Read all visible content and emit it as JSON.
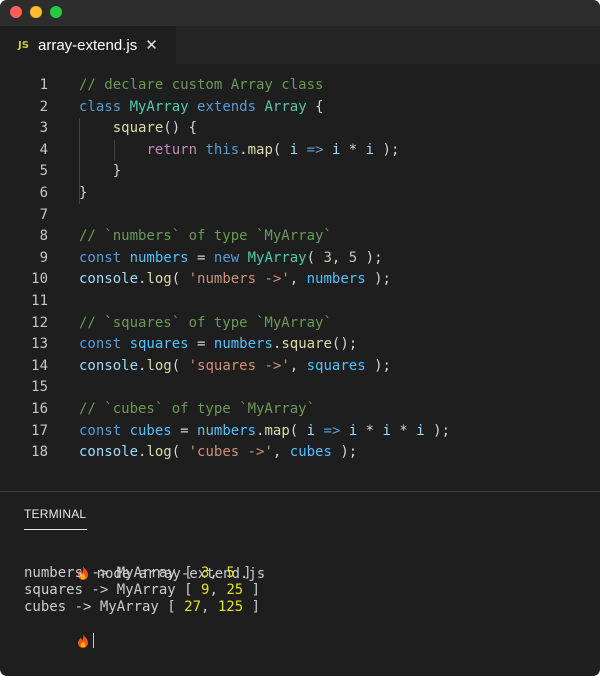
{
  "window": {
    "traffic_lights": [
      "close",
      "minimize",
      "zoom"
    ],
    "colors": {
      "background": "#1e1e1e",
      "titlebar": "#2d2d2d",
      "tabbar": "#252526"
    }
  },
  "tab": {
    "icon_label": "JS",
    "filename": "array-extend.js",
    "close_glyph": "✕"
  },
  "code_lines": [
    {
      "num": "1",
      "tokens": [
        {
          "t": "// declare custom Array class",
          "c": "comment"
        }
      ]
    },
    {
      "num": "2",
      "tokens": [
        {
          "t": "class ",
          "c": "keyword"
        },
        {
          "t": "MyArray",
          "c": "class"
        },
        {
          "t": " ",
          "c": "plain"
        },
        {
          "t": "extends",
          "c": "keyword"
        },
        {
          "t": " ",
          "c": "plain"
        },
        {
          "t": "Array",
          "c": "class"
        },
        {
          "t": " {",
          "c": "plain"
        }
      ]
    },
    {
      "num": "3",
      "tokens": [
        {
          "t": "    ",
          "c": "plain"
        },
        {
          "t": "square",
          "c": "func"
        },
        {
          "t": "() {",
          "c": "plain"
        }
      ]
    },
    {
      "num": "4",
      "tokens": [
        {
          "t": "        ",
          "c": "plain"
        },
        {
          "t": "return ",
          "c": "control"
        },
        {
          "t": "this",
          "c": "keyword"
        },
        {
          "t": ".",
          "c": "plain"
        },
        {
          "t": "map",
          "c": "func"
        },
        {
          "t": "( ",
          "c": "plain"
        },
        {
          "t": "i",
          "c": "var"
        },
        {
          "t": " ",
          "c": "plain"
        },
        {
          "t": "=>",
          "c": "keyword"
        },
        {
          "t": " ",
          "c": "plain"
        },
        {
          "t": "i",
          "c": "var"
        },
        {
          "t": " * ",
          "c": "plain"
        },
        {
          "t": "i",
          "c": "var"
        },
        {
          "t": " );",
          "c": "plain"
        }
      ]
    },
    {
      "num": "5",
      "tokens": [
        {
          "t": "    }",
          "c": "plain"
        }
      ]
    },
    {
      "num": "6",
      "tokens": [
        {
          "t": "}",
          "c": "plain"
        }
      ]
    },
    {
      "num": "7",
      "tokens": []
    },
    {
      "num": "8",
      "tokens": [
        {
          "t": "// `numbers` of type `MyArray`",
          "c": "comment"
        }
      ]
    },
    {
      "num": "9",
      "tokens": [
        {
          "t": "const ",
          "c": "keyword"
        },
        {
          "t": "numbers",
          "c": "const"
        },
        {
          "t": " = ",
          "c": "plain"
        },
        {
          "t": "new ",
          "c": "keyword"
        },
        {
          "t": "MyArray",
          "c": "class"
        },
        {
          "t": "( ",
          "c": "plain"
        },
        {
          "t": "3",
          "c": "number"
        },
        {
          "t": ", ",
          "c": "plain"
        },
        {
          "t": "5",
          "c": "number"
        },
        {
          "t": " );",
          "c": "plain"
        }
      ]
    },
    {
      "num": "10",
      "tokens": [
        {
          "t": "console",
          "c": "var"
        },
        {
          "t": ".",
          "c": "plain"
        },
        {
          "t": "log",
          "c": "func"
        },
        {
          "t": "( ",
          "c": "plain"
        },
        {
          "t": "'numbers ->'",
          "c": "string"
        },
        {
          "t": ", ",
          "c": "plain"
        },
        {
          "t": "numbers",
          "c": "const"
        },
        {
          "t": " );",
          "c": "plain"
        }
      ]
    },
    {
      "num": "11",
      "tokens": []
    },
    {
      "num": "12",
      "tokens": [
        {
          "t": "// `squares` of type `MyArray`",
          "c": "comment"
        }
      ]
    },
    {
      "num": "13",
      "tokens": [
        {
          "t": "const ",
          "c": "keyword"
        },
        {
          "t": "squares",
          "c": "const"
        },
        {
          "t": " = ",
          "c": "plain"
        },
        {
          "t": "numbers",
          "c": "const"
        },
        {
          "t": ".",
          "c": "plain"
        },
        {
          "t": "square",
          "c": "func"
        },
        {
          "t": "();",
          "c": "plain"
        }
      ]
    },
    {
      "num": "14",
      "tokens": [
        {
          "t": "console",
          "c": "var"
        },
        {
          "t": ".",
          "c": "plain"
        },
        {
          "t": "log",
          "c": "func"
        },
        {
          "t": "( ",
          "c": "plain"
        },
        {
          "t": "'squares ->'",
          "c": "string"
        },
        {
          "t": ", ",
          "c": "plain"
        },
        {
          "t": "squares",
          "c": "const"
        },
        {
          "t": " );",
          "c": "plain"
        }
      ]
    },
    {
      "num": "15",
      "tokens": []
    },
    {
      "num": "16",
      "tokens": [
        {
          "t": "// `cubes` of type `MyArray`",
          "c": "comment"
        }
      ]
    },
    {
      "num": "17",
      "tokens": [
        {
          "t": "const ",
          "c": "keyword"
        },
        {
          "t": "cubes",
          "c": "const"
        },
        {
          "t": " = ",
          "c": "plain"
        },
        {
          "t": "numbers",
          "c": "const"
        },
        {
          "t": ".",
          "c": "plain"
        },
        {
          "t": "map",
          "c": "func"
        },
        {
          "t": "( ",
          "c": "plain"
        },
        {
          "t": "i",
          "c": "var"
        },
        {
          "t": " ",
          "c": "plain"
        },
        {
          "t": "=>",
          "c": "keyword"
        },
        {
          "t": " ",
          "c": "plain"
        },
        {
          "t": "i",
          "c": "var"
        },
        {
          "t": " * ",
          "c": "plain"
        },
        {
          "t": "i",
          "c": "var"
        },
        {
          "t": " * ",
          "c": "plain"
        },
        {
          "t": "i",
          "c": "var"
        },
        {
          "t": " );",
          "c": "plain"
        }
      ]
    },
    {
      "num": "18",
      "tokens": [
        {
          "t": "console",
          "c": "var"
        },
        {
          "t": ".",
          "c": "plain"
        },
        {
          "t": "log",
          "c": "func"
        },
        {
          "t": "( ",
          "c": "plain"
        },
        {
          "t": "'cubes ->'",
          "c": "string"
        },
        {
          "t": ", ",
          "c": "plain"
        },
        {
          "t": "cubes",
          "c": "const"
        },
        {
          "t": " );",
          "c": "plain"
        }
      ]
    }
  ],
  "terminal": {
    "tab_label": "TERMINAL",
    "prompt_icon": "fire-icon",
    "command": "node array-extend.js",
    "output": [
      {
        "label": "numbers -> MyArray [ ",
        "values": [
          "3",
          "5"
        ],
        "close": " ]"
      },
      {
        "label": "squares -> MyArray [ ",
        "values": [
          "9",
          "25"
        ],
        "close": " ]"
      },
      {
        "label": "cubes -> MyArray [ ",
        "values": [
          "27",
          "125"
        ],
        "close": " ]"
      }
    ]
  }
}
